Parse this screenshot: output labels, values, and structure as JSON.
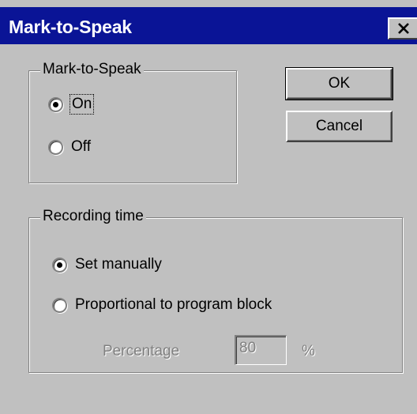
{
  "window": {
    "title": "Mark-to-Speak",
    "close_icon": "close-icon"
  },
  "mark_group": {
    "legend": "Mark-to-Speak",
    "options": [
      {
        "label": "On",
        "checked": true
      },
      {
        "label": "Off",
        "checked": false
      }
    ]
  },
  "buttons": {
    "ok_label": "OK",
    "cancel_label": "Cancel"
  },
  "recording_group": {
    "legend": "Recording time",
    "options": [
      {
        "label": "Set manually",
        "checked": true
      },
      {
        "label": "Proportional to program block",
        "checked": false
      }
    ],
    "percentage_label": "Percentage",
    "percentage_value": "80",
    "percentage_unit": "%"
  },
  "colors": {
    "titlebar": "#0a1496",
    "face": "#c0c0c0",
    "disabled_text": "#808080"
  }
}
